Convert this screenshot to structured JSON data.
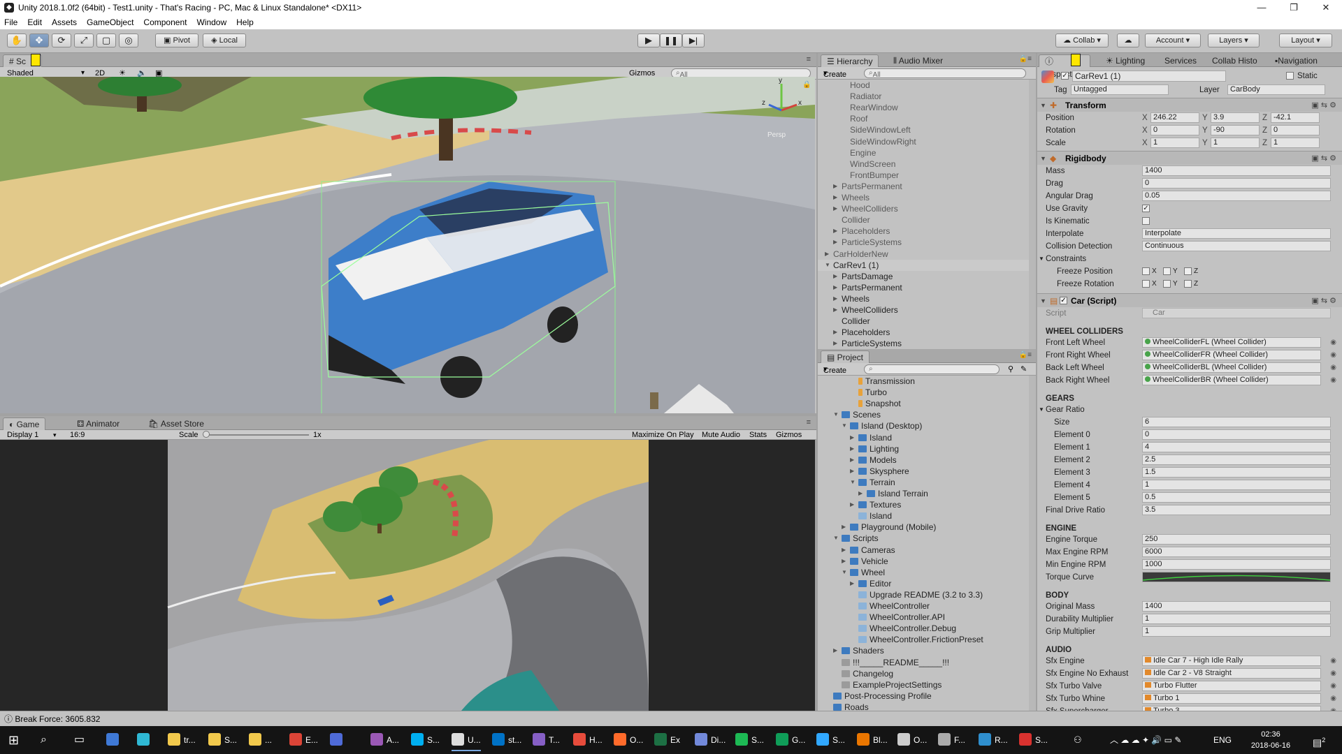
{
  "window": {
    "title": "Unity 2018.1.0f2 (64bit) - Test1.unity - That's Racing - PC, Mac & Linux Standalone* <DX11>"
  },
  "menu": [
    "File",
    "Edit",
    "Assets",
    "GameObject",
    "Component",
    "Window",
    "Help"
  ],
  "toolbar": {
    "pivot": "Pivot",
    "local": "Local",
    "collab": "Collab",
    "account": "Account",
    "layers": "Layers",
    "layout": "Layout"
  },
  "scene": {
    "tab": "Sc",
    "shading": "Shaded",
    "mode2d": "2D",
    "gizmos": "Gizmos",
    "search_placeholder": "All",
    "persp": "Persp"
  },
  "game": {
    "tabs": [
      "Game",
      "Animator",
      "Asset Store"
    ],
    "display": "Display 1",
    "aspect": "16:9",
    "scale_label": "Scale",
    "scale_value": "1x",
    "options": [
      "Maximize On Play",
      "Mute Audio",
      "Stats",
      "Gizmos"
    ]
  },
  "hierarchy": {
    "tabs": [
      "Hierarchy",
      "Audio Mixer"
    ],
    "create": "Create",
    "search_placeholder": "All",
    "rows": [
      {
        "label": "Hood",
        "indent": 3,
        "arrow": false,
        "muted": true
      },
      {
        "label": "Radiator",
        "indent": 3,
        "arrow": false,
        "muted": true
      },
      {
        "label": "RearWindow",
        "indent": 3,
        "arrow": false,
        "muted": true
      },
      {
        "label": "Roof",
        "indent": 3,
        "arrow": false,
        "muted": true
      },
      {
        "label": "SideWindowLeft",
        "indent": 3,
        "arrow": false,
        "muted": true
      },
      {
        "label": "SideWindowRight",
        "indent": 3,
        "arrow": false,
        "muted": true
      },
      {
        "label": "Engine",
        "indent": 3,
        "arrow": false,
        "muted": true
      },
      {
        "label": "WindScreen",
        "indent": 3,
        "arrow": false,
        "muted": true
      },
      {
        "label": "FrontBumper",
        "indent": 3,
        "arrow": false,
        "muted": true
      },
      {
        "label": "PartsPermanent",
        "indent": 2,
        "arrow": "right",
        "muted": true
      },
      {
        "label": "Wheels",
        "indent": 2,
        "arrow": "right",
        "muted": true
      },
      {
        "label": "WheelColliders",
        "indent": 2,
        "arrow": "right",
        "muted": true
      },
      {
        "label": "Collider",
        "indent": 2,
        "arrow": false,
        "muted": true
      },
      {
        "label": "Placeholders",
        "indent": 2,
        "arrow": "right",
        "muted": true
      },
      {
        "label": "ParticleSystems",
        "indent": 2,
        "arrow": "right",
        "muted": true
      },
      {
        "label": "CarHolderNew",
        "indent": 1,
        "arrow": "right",
        "muted": true
      },
      {
        "label": "CarRev1 (1)",
        "indent": 1,
        "arrow": "down",
        "muted": false,
        "selected": true
      },
      {
        "label": "PartsDamage",
        "indent": 2,
        "arrow": "right",
        "muted": false
      },
      {
        "label": "PartsPermanent",
        "indent": 2,
        "arrow": "right",
        "muted": false
      },
      {
        "label": "Wheels",
        "indent": 2,
        "arrow": "right",
        "muted": false
      },
      {
        "label": "WheelColliders",
        "indent": 2,
        "arrow": "right",
        "muted": false
      },
      {
        "label": "Collider",
        "indent": 2,
        "arrow": false,
        "muted": false
      },
      {
        "label": "Placeholders",
        "indent": 2,
        "arrow": "right",
        "muted": false
      },
      {
        "label": "ParticleSystems",
        "indent": 2,
        "arrow": "right",
        "muted": false
      }
    ]
  },
  "project": {
    "tab": "Project",
    "create": "Create",
    "rows": [
      {
        "label": "Transmission",
        "indent": 4,
        "arrow": false,
        "icon": "orange"
      },
      {
        "label": "Turbo",
        "indent": 4,
        "arrow": false,
        "icon": "orange"
      },
      {
        "label": "Snapshot",
        "indent": 4,
        "arrow": false,
        "icon": "orange"
      },
      {
        "label": "Scenes",
        "indent": 2,
        "arrow": "down",
        "icon": "folder"
      },
      {
        "label": "Island (Desktop)",
        "indent": 3,
        "arrow": "down",
        "icon": "folder"
      },
      {
        "label": "Island",
        "indent": 4,
        "arrow": "right",
        "icon": "folder"
      },
      {
        "label": "Lighting",
        "indent": 4,
        "arrow": "right",
        "icon": "folder"
      },
      {
        "label": "Models",
        "indent": 4,
        "arrow": "right",
        "icon": "folder"
      },
      {
        "label": "Skysphere",
        "indent": 4,
        "arrow": "right",
        "icon": "folder"
      },
      {
        "label": "Terrain",
        "indent": 4,
        "arrow": "down",
        "icon": "folder"
      },
      {
        "label": "Island Terrain",
        "indent": 5,
        "arrow": "right",
        "icon": "folder"
      },
      {
        "label": "Textures",
        "indent": 4,
        "arrow": "right",
        "icon": "folder"
      },
      {
        "label": "Island",
        "indent": 4,
        "arrow": false,
        "icon": "script"
      },
      {
        "label": "Playground (Mobile)",
        "indent": 3,
        "arrow": "right",
        "icon": "folder"
      },
      {
        "label": "Scripts",
        "indent": 2,
        "arrow": "down",
        "icon": "folder"
      },
      {
        "label": "Cameras",
        "indent": 3,
        "arrow": "right",
        "icon": "folder"
      },
      {
        "label": "Vehicle",
        "indent": 3,
        "arrow": "right",
        "icon": "folder"
      },
      {
        "label": "Wheel",
        "indent": 3,
        "arrow": "down",
        "icon": "folder"
      },
      {
        "label": "Editor",
        "indent": 4,
        "arrow": "right",
        "icon": "folder"
      },
      {
        "label": "Upgrade README (3.2 to 3.3)",
        "indent": 4,
        "arrow": false,
        "icon": "script"
      },
      {
        "label": "WheelController",
        "indent": 4,
        "arrow": false,
        "icon": "script"
      },
      {
        "label": "WheelController.API",
        "indent": 4,
        "arrow": false,
        "icon": "script"
      },
      {
        "label": "WheelController.Debug",
        "indent": 4,
        "arrow": false,
        "icon": "script"
      },
      {
        "label": "WheelController.FrictionPreset",
        "indent": 4,
        "arrow": false,
        "icon": "script"
      },
      {
        "label": "Shaders",
        "indent": 2,
        "arrow": "right",
        "icon": "folder"
      },
      {
        "label": "!!!_____README_____!!!",
        "indent": 2,
        "arrow": false,
        "icon": "gray"
      },
      {
        "label": "Changelog",
        "indent": 2,
        "arrow": false,
        "icon": "gray"
      },
      {
        "label": "ExampleProjectSettings",
        "indent": 2,
        "arrow": false,
        "icon": "gray"
      },
      {
        "label": "Post-Processing Profile",
        "indent": 1,
        "arrow": false,
        "icon": "folder"
      },
      {
        "label": "Roads",
        "indent": 1,
        "arrow": false,
        "icon": "folder"
      }
    ]
  },
  "inspector": {
    "tabs": [
      "Inspector",
      "Lighting",
      "Services",
      "Collab Histo",
      "Navigation"
    ],
    "object_name": "CarRev1 (1)",
    "static_label": "Static",
    "tag_label": "Tag",
    "tag_value": "Untagged",
    "layer_label": "Layer",
    "layer_value": "CarBody",
    "transform": {
      "title": "Transform",
      "position": {
        "label": "Position",
        "x": "246.22",
        "y": "3.9",
        "z": "-42.1"
      },
      "rotation": {
        "label": "Rotation",
        "x": "0",
        "y": "-90",
        "z": "0"
      },
      "scale": {
        "label": "Scale",
        "x": "1",
        "y": "1",
        "z": "1"
      }
    },
    "rigidbody": {
      "title": "Rigidbody",
      "mass": {
        "label": "Mass",
        "value": "1400"
      },
      "drag": {
        "label": "Drag",
        "value": "0"
      },
      "angular_drag": {
        "label": "Angular Drag",
        "value": "0.05"
      },
      "use_gravity": {
        "label": "Use Gravity",
        "checked": true
      },
      "is_kinematic": {
        "label": "Is Kinematic",
        "checked": false
      },
      "interpolate": {
        "label": "Interpolate",
        "value": "Interpolate"
      },
      "collision": {
        "label": "Collision Detection",
        "value": "Continuous"
      },
      "constraints": "Constraints",
      "freeze_pos": "Freeze Position",
      "freeze_rot": "Freeze Rotation"
    },
    "car_script": {
      "title": "Car (Script)",
      "script_label": "Script",
      "script_value": "Car",
      "sections": [
        {
          "title": "WHEEL COLLIDERS",
          "rows": [
            {
              "label": "Front Left Wheel",
              "value": "WheelColliderFL (Wheel Collider)",
              "ref": "dot"
            },
            {
              "label": "Front Right Wheel",
              "value": "WheelColliderFR (Wheel Collider)",
              "ref": "dot"
            },
            {
              "label": "Back Left Wheel",
              "value": "WheelColliderBL (Wheel Collider)",
              "ref": "dot"
            },
            {
              "label": "Back Right Wheel",
              "value": "WheelColliderBR (Wheel Collider)",
              "ref": "dot"
            }
          ]
        },
        {
          "title": "GEARS",
          "rows": [
            {
              "label": "Gear Ratio",
              "value": "",
              "ref": "fold"
            },
            {
              "label": "Size",
              "value": "6",
              "ref": "sub"
            },
            {
              "label": "Element 0",
              "value": "0",
              "ref": "sub"
            },
            {
              "label": "Element 1",
              "value": "4",
              "ref": "sub"
            },
            {
              "label": "Element 2",
              "value": "2.5",
              "ref": "sub"
            },
            {
              "label": "Element 3",
              "value": "1.5",
              "ref": "sub"
            },
            {
              "label": "Element 4",
              "value": "1",
              "ref": "sub"
            },
            {
              "label": "Element 5",
              "value": "0.5",
              "ref": "sub"
            },
            {
              "label": "Final Drive Ratio",
              "value": "3.5",
              "ref": ""
            }
          ]
        },
        {
          "title": "ENGINE",
          "rows": [
            {
              "label": "Engine Torque",
              "value": "250",
              "ref": ""
            },
            {
              "label": "Max Engine RPM",
              "value": "6000",
              "ref": ""
            },
            {
              "label": "Min Engine RPM",
              "value": "1000",
              "ref": ""
            },
            {
              "label": "Torque Curve",
              "value": "",
              "ref": "curve"
            }
          ]
        },
        {
          "title": "BODY",
          "rows": [
            {
              "label": "Original Mass",
              "value": "1400",
              "ref": ""
            },
            {
              "label": "Durability Multiplier",
              "value": "1",
              "ref": ""
            },
            {
              "label": "Grip Multiplier",
              "value": "1",
              "ref": ""
            }
          ]
        },
        {
          "title": "AUDIO",
          "rows": [
            {
              "label": "Sfx Engine",
              "value": "Idle Car 7 - High Idle Rally",
              "ref": "aud"
            },
            {
              "label": "Sfx Engine No Exhaust",
              "value": "Idle Car 2 - V8 Straight",
              "ref": "aud"
            },
            {
              "label": "Sfx Turbo Valve",
              "value": "Turbo Flutter",
              "ref": "aud"
            },
            {
              "label": "Sfx Turbo Whine",
              "value": "Turbo 1",
              "ref": "aud"
            },
            {
              "label": "Sfx Supercharger",
              "value": "Turbo 3",
              "ref": "aud"
            }
          ]
        }
      ]
    }
  },
  "status": {
    "text": "Break Force: 3605.832"
  },
  "taskbar": {
    "items": [
      {
        "label": "tr...",
        "color": "#f2c94c"
      },
      {
        "label": "S...",
        "color": "#f2c94c"
      },
      {
        "label": "...",
        "color": "#f2c94c"
      },
      {
        "label": "E...",
        "color": "#db4437"
      },
      {
        "label": "",
        "color": "#4f6bd8"
      },
      {
        "label": "A...",
        "color": "#9b59b6"
      },
      {
        "label": "S...",
        "color": "#00aff0"
      },
      {
        "label": "U...",
        "color": "#dddddd"
      },
      {
        "label": "st...",
        "color": "#0072c6"
      },
      {
        "label": "T...",
        "color": "#865fc5"
      },
      {
        "label": "H...",
        "color": "#e74c3c"
      },
      {
        "label": "O...",
        "color": "#ff6b2b"
      },
      {
        "label": "Ex",
        "color": "#1d7044"
      },
      {
        "label": "Di...",
        "color": "#7289da"
      },
      {
        "label": "S...",
        "color": "#1db954"
      },
      {
        "label": "G...",
        "color": "#0f9d58"
      },
      {
        "label": "S...",
        "color": "#31a8ff"
      },
      {
        "label": "Bl...",
        "color": "#ea7600"
      },
      {
        "label": "O...",
        "color": "#cccccc"
      },
      {
        "label": "F...",
        "color": "#aaaaaa"
      },
      {
        "label": "R...",
        "color": "#2f8fce"
      },
      {
        "label": "S...",
        "color": "#d9322f"
      }
    ],
    "lang": "ENG",
    "time": "02:36",
    "date": "2018-06-16",
    "notify": "2"
  }
}
